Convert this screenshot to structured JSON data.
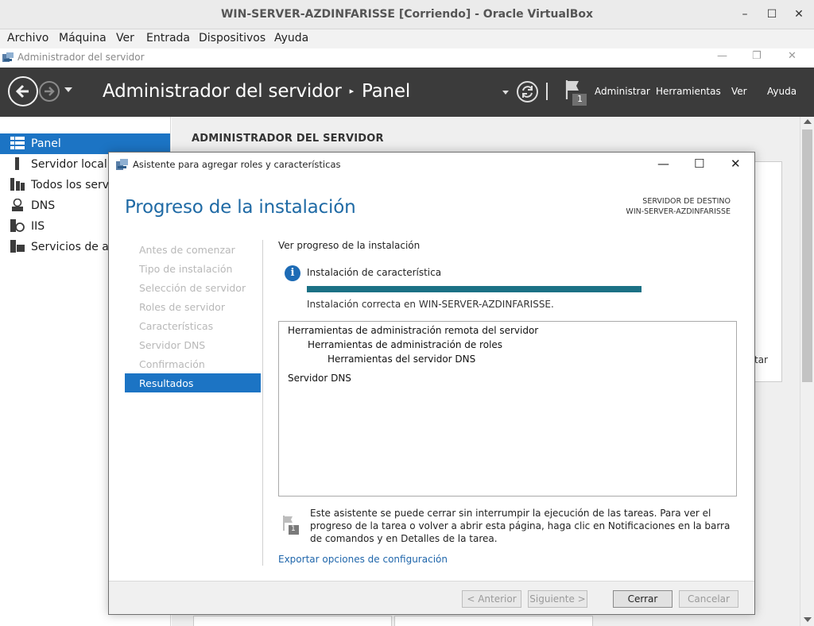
{
  "vbox": {
    "title": "WIN-SERVER-AZDINFARISSE [Corriendo] - Oracle VirtualBox",
    "menu": [
      "Archivo",
      "Máquina",
      "Ver",
      "Entrada",
      "Dispositivos",
      "Ayuda"
    ]
  },
  "server_manager": {
    "window_title": "Administrador del servidor",
    "heading": "Administrador del servidor",
    "heading_sep": "▸",
    "heading_page": "Panel",
    "header_links": [
      "Administrar",
      "Herramientas",
      "Ver",
      "Ayuda"
    ],
    "notification_count": "1",
    "nav": [
      {
        "label": "Panel",
        "icon": "dashboard-icon",
        "active": true
      },
      {
        "label": "Servidor local",
        "icon": "server-icon",
        "active": false
      },
      {
        "label": "Todos los servid",
        "icon": "servers-icon",
        "active": false
      },
      {
        "label": "DNS",
        "icon": "dns-icon",
        "active": false
      },
      {
        "label": "IIS",
        "icon": "iis-icon",
        "active": false
      },
      {
        "label": "Servicios de arch",
        "icon": "file-services-icon",
        "active": false
      }
    ],
    "main_title": "ADMINISTRADOR DEL SERVIDOR",
    "main_card_fragment": "tar"
  },
  "wizard": {
    "title": "Asistente para agregar roles y características",
    "heading": "Progreso de la instalación",
    "dest_label": "SERVIDOR DE DESTINO",
    "dest_name": "WIN-SERVER-AZDINFARISSE",
    "steps": [
      {
        "label": "Antes de comenzar",
        "active": false
      },
      {
        "label": "Tipo de instalación",
        "active": false
      },
      {
        "label": "Selección de servidor",
        "active": false
      },
      {
        "label": "Roles de servidor",
        "active": false
      },
      {
        "label": "Características",
        "active": false
      },
      {
        "label": "Servidor DNS",
        "active": false
      },
      {
        "label": "Confirmación",
        "active": false
      },
      {
        "label": "Resultados",
        "active": true
      }
    ],
    "subheading": "Ver progreso de la instalación",
    "feature_label": "Instalación de característica",
    "progress": 1.0,
    "success": "Instalación correcta en WIN-SERVER-AZDINFARISSE.",
    "results": [
      {
        "text": "Herramientas de administración remota del servidor",
        "level": 0
      },
      {
        "text": "Herramientas de administración de roles",
        "level": 1
      },
      {
        "text": "Herramientas del servidor DNS",
        "level": 2
      },
      {
        "text": "Servidor DNS",
        "level": 0
      }
    ],
    "note": "Este asistente se puede cerrar sin interrumpir la ejecución de las tareas. Para ver el progreso de la tarea o volver a abrir esta página, haga clic en Notificaciones en la barra de comandos y en Detalles de la tarea.",
    "note_badge": "1",
    "export_link": "Exportar opciones de configuración",
    "buttons": {
      "previous": "< Anterior",
      "next": "Siguiente >",
      "close": "Cerrar",
      "cancel": "Cancelar"
    }
  },
  "colors": {
    "accent": "#1c74c4",
    "progress": "#1b7185",
    "header_bg": "#3b3b3b"
  }
}
